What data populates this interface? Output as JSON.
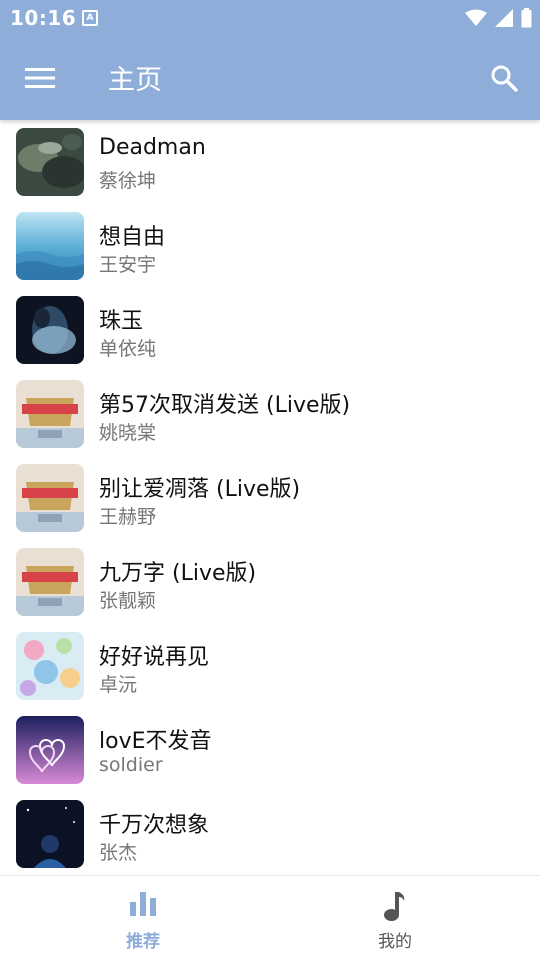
{
  "status_bar": {
    "time": "10:16",
    "notification_glyph": "A"
  },
  "app_bar": {
    "title": "主页",
    "background": "#8fadd9"
  },
  "songs": [
    {
      "title": "Deadman",
      "artist": "蔡徐坤"
    },
    {
      "title": "想自由",
      "artist": "王安宇"
    },
    {
      "title": "珠玉",
      "artist": "单依纯"
    },
    {
      "title": "第57次取消发送 (Live版)",
      "artist": "姚晓棠"
    },
    {
      "title": "别让爱凋落 (Live版)",
      "artist": "王赫野"
    },
    {
      "title": "九万字 (Live版)",
      "artist": "张靓颖"
    },
    {
      "title": "好好说再见",
      "artist": "卓沅"
    },
    {
      "title": "lovE不发音",
      "artist": "soldier"
    },
    {
      "title": "千万次想象",
      "artist": "张杰"
    }
  ],
  "bottom_nav": {
    "tabs": [
      {
        "label": "推荐",
        "icon": "bar-chart-icon",
        "active": true
      },
      {
        "label": "我的",
        "icon": "music-note-icon",
        "active": false
      }
    ],
    "active_color": "#8fadd9"
  }
}
